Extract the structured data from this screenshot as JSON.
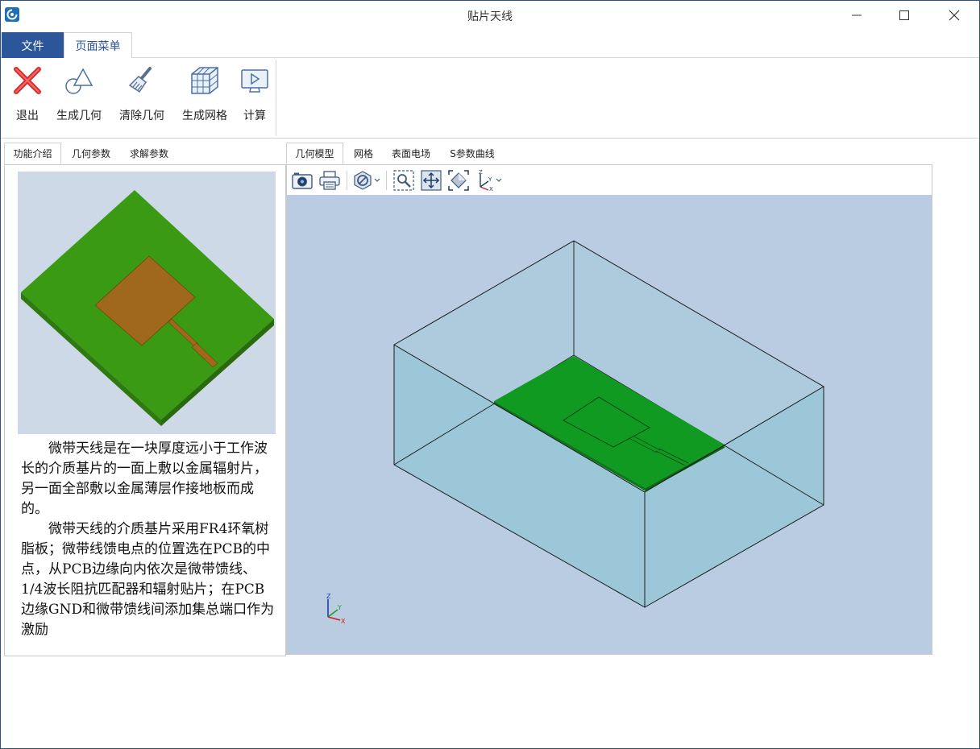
{
  "window": {
    "title": "贴片天线"
  },
  "menubar": {
    "file_label": "文件",
    "page_menu_label": "页面菜单"
  },
  "ribbon": {
    "buttons": [
      {
        "label": "退出",
        "icon": "exit-icon"
      },
      {
        "label": "生成几何",
        "icon": "geometry-icon"
      },
      {
        "label": "清除几何",
        "icon": "clear-brush-icon"
      },
      {
        "label": "生成网格",
        "icon": "mesh-cube-icon"
      },
      {
        "label": "计算",
        "icon": "compute-monitor-icon"
      }
    ]
  },
  "left_tabs": [
    "功能介绍",
    "几何参数",
    "求解参数"
  ],
  "right_tabs": [
    "几何模型",
    "网格",
    "表面电场",
    "S参数曲线"
  ],
  "description": {
    "paragraph1": "微带天线是在一块厚度远小于工作波长的介质基片的一面上敷以金属辐射片，另一面全部敷以金属薄层作接地板而成的。",
    "paragraph2": "微带天线的介质基片采用FR4环氧树脂板；微带线馈电点的位置选在PCB的中点，从PCB边缘向内依次是微带馈线、1/4波长阻抗匹配器和辐射贴片；在PCB边缘GND和微带馈线间添加集总端口作为激励"
  },
  "axes": {
    "x": "X",
    "y": "Y",
    "z": "Z"
  },
  "colors": {
    "accent": "#2b579a",
    "substrate": "#3a9a14",
    "patch": "#a0681a",
    "viewport_bg": "#b9cce2",
    "air_box": "#9cc7d8"
  }
}
